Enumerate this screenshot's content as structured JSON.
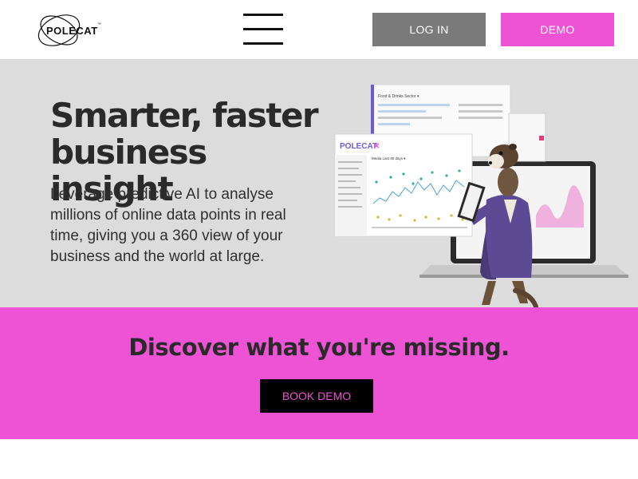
{
  "header": {
    "logo_text": "POLECAT",
    "logo_tm": "™",
    "menu_icon": "hamburger-icon",
    "login_label": "LOG IN",
    "demo_label": "DEMO"
  },
  "hero": {
    "headline": "Smarter, faster business insight",
    "subtext": "Leverage predictive AI to analyse millions of online data points in real time, giving you a 360 view of your business and the world at large.",
    "illustration": {
      "brand": "POLECAT",
      "chart_title": "Media Last 90 days ▾",
      "panel_title": "Food & Drinks Sector ▾"
    }
  },
  "cta": {
    "title": "Discover what you're missing.",
    "button_label": "BOOK DEMO"
  },
  "colors": {
    "accent_pink": "#ee52d5",
    "login_gray": "#7a7a7a",
    "hero_bg": "#dcdcdc"
  }
}
